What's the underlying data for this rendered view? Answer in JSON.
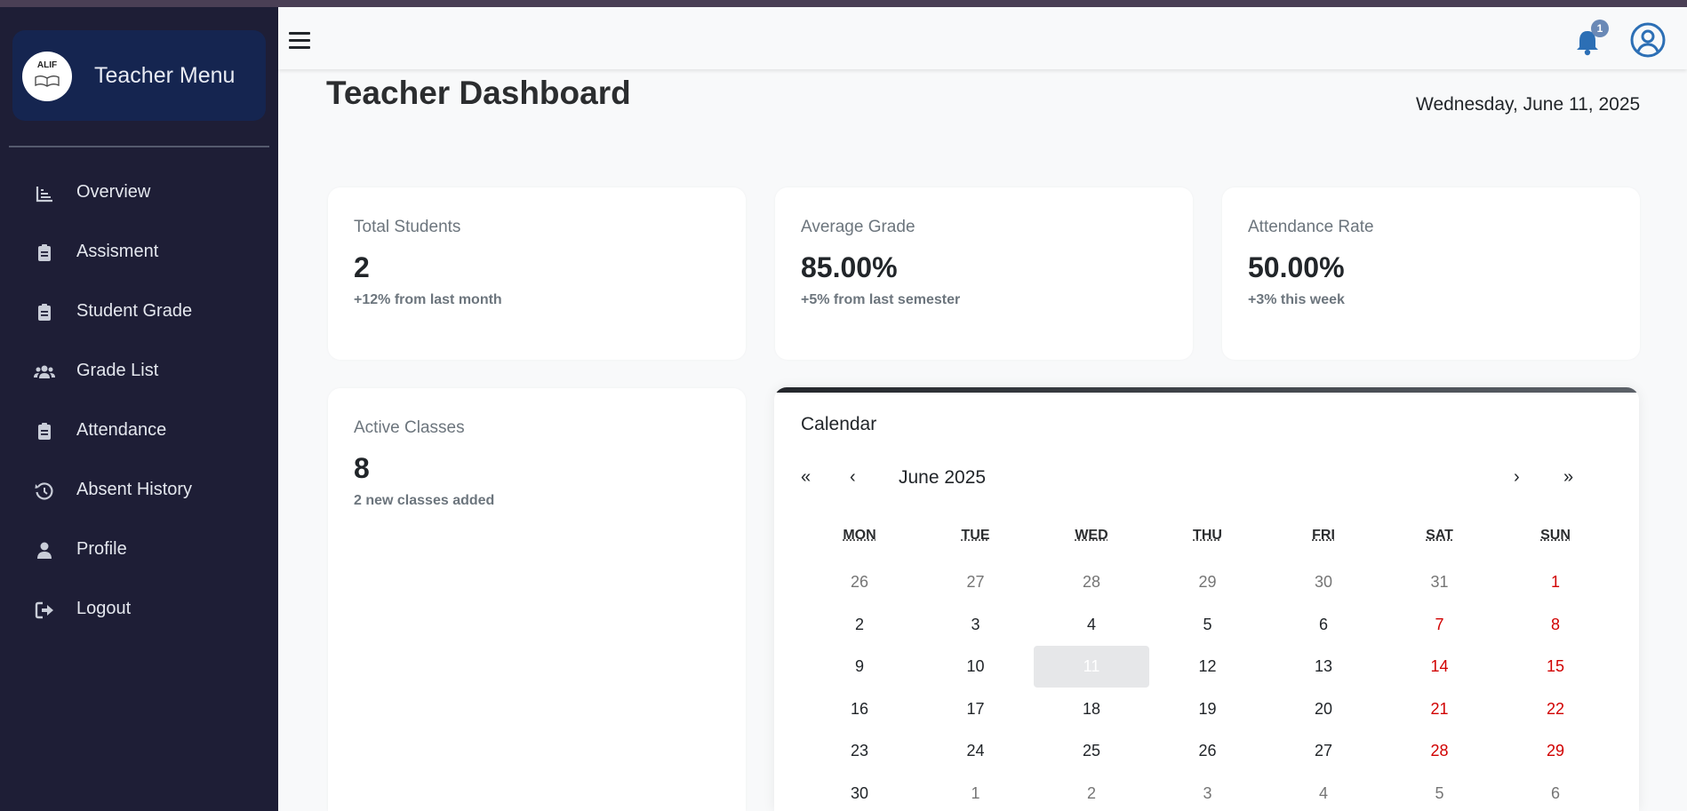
{
  "sidebar": {
    "brand_logo_text": "ALIF",
    "title": "Teacher Menu",
    "items": [
      {
        "label": "Overview",
        "icon": "chart-line-icon"
      },
      {
        "label": "Assisment",
        "icon": "clipboard-icon"
      },
      {
        "label": "Student Grade",
        "icon": "clipboard-icon"
      },
      {
        "label": "Grade List",
        "icon": "users-icon"
      },
      {
        "label": "Attendance",
        "icon": "clipboard-icon"
      },
      {
        "label": "Absent History",
        "icon": "history-icon"
      },
      {
        "label": "Profile",
        "icon": "user-icon"
      },
      {
        "label": "Logout",
        "icon": "sign-out-icon"
      }
    ]
  },
  "topbar": {
    "menu_icon": "hamburger-icon",
    "notification_icon": "bell-icon",
    "notification_count": "1",
    "profile_icon": "user-circle-icon"
  },
  "page": {
    "title": "Teacher Dashboard",
    "date": "Wednesday, June 11, 2025"
  },
  "stats": {
    "total_students": {
      "label": "Total Students",
      "value": "2",
      "sub": "+12% from last month"
    },
    "average_grade": {
      "label": "Average Grade",
      "value": "85.00%",
      "sub": "+5% from last semester"
    },
    "attendance_rate": {
      "label": "Attendance Rate",
      "value": "50.00%",
      "sub": "+3% this week"
    },
    "active_classes": {
      "label": "Active Classes",
      "value": "8",
      "sub": "2 new classes added"
    }
  },
  "calendar": {
    "title": "Calendar",
    "nav_prev_year": "«",
    "nav_prev_month": "‹",
    "month_label": "June 2025",
    "nav_next_month": "›",
    "nav_next_year": "»",
    "weekdays": [
      "MON",
      "TUE",
      "WED",
      "THU",
      "FRI",
      "SAT",
      "SUN"
    ],
    "selected_day": "11",
    "weeks": [
      [
        "26",
        "27",
        "28",
        "29",
        "30",
        "31",
        "1"
      ],
      [
        "2",
        "3",
        "4",
        "5",
        "6",
        "7",
        "8"
      ],
      [
        "9",
        "10",
        "11",
        "12",
        "13",
        "14",
        "15"
      ],
      [
        "16",
        "17",
        "18",
        "19",
        "20",
        "21",
        "22"
      ],
      [
        "23",
        "24",
        "25",
        "26",
        "27",
        "28",
        "29"
      ],
      [
        "30",
        "1",
        "2",
        "3",
        "4",
        "5",
        "6"
      ]
    ]
  },
  "colors": {
    "sidebar_bg": "#1e1e36",
    "brand_bg": "#152550",
    "accent_blue": "#2c6fb5",
    "weekend_red": "#d10000",
    "badge": "#6a89b6"
  }
}
